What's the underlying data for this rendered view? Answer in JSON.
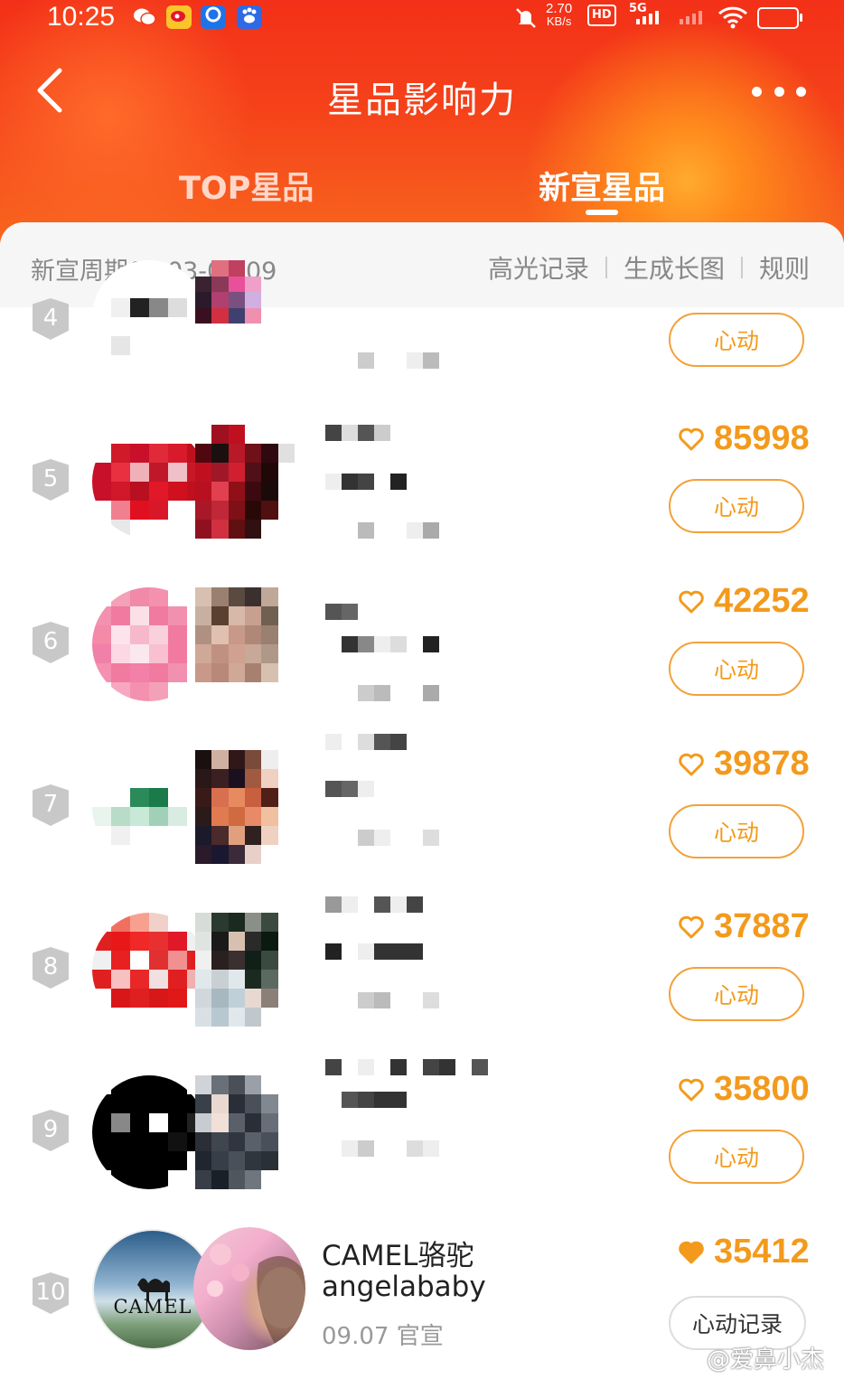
{
  "status_bar": {
    "time": "10:25",
    "net_speed_value": "2.70",
    "net_speed_unit": "KB/s",
    "hd_label": "HD",
    "hd_sub": "1",
    "network": "5G"
  },
  "header": {
    "title": "星品影响力",
    "tabs": [
      {
        "label": "TOP星品",
        "active": false
      },
      {
        "label": "新宣星品",
        "active": true
      }
    ]
  },
  "toolbar": {
    "period": "新宣周期09.03-09.09",
    "links": [
      "高光记录",
      "生成长图",
      "规则"
    ]
  },
  "rows": [
    {
      "rank": "4",
      "name_partial": "…",
      "count": "",
      "button": "心动"
    },
    {
      "rank": "5",
      "count": "85998",
      "button": "心动"
    },
    {
      "rank": "6",
      "count": "42252",
      "button": "心动"
    },
    {
      "rank": "7",
      "count": "39878",
      "button": "心动"
    },
    {
      "rank": "8",
      "count": "37887",
      "button": "心动"
    },
    {
      "rank": "9",
      "count": "35800",
      "button": "心动"
    },
    {
      "rank": "10",
      "brand": "CAMEL骆驼",
      "star": "angelababy",
      "date": "09.07 官宣",
      "count": "35412",
      "button": "心动记录",
      "logo_text": "CAMEL"
    }
  ],
  "watermark": "@爱鼻小杰",
  "colors": {
    "accent": "#f39a1c",
    "header": "#f4381a"
  }
}
